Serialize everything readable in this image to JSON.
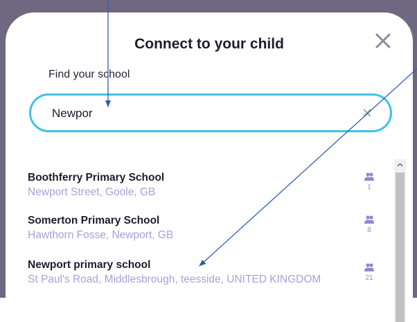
{
  "modal": {
    "title": "Connect to your child",
    "close_icon": "close-icon"
  },
  "search": {
    "label": "Find your school",
    "value": "Newpor",
    "clear_icon": "clear-icon"
  },
  "results": [
    {
      "name": "Boothferry Primary School",
      "address": "Newport Street, Goole, GB",
      "count": "1"
    },
    {
      "name": "Somerton Primary School",
      "address": "Hawthorn Fosse, Newport, GB",
      "count": "8"
    },
    {
      "name": "Newport primary school",
      "address": "St Paul's Road, Middlesbrough, teesside, UNITED KINGDOM",
      "count": "21"
    }
  ],
  "colors": {
    "accent": "#3ec2ea",
    "address": "#a3a2db",
    "backdrop": "#6f6880",
    "annotation": "#2e5fa8"
  },
  "icons": {
    "people": "people-icon",
    "scroll_up": "chevron-up-icon"
  }
}
